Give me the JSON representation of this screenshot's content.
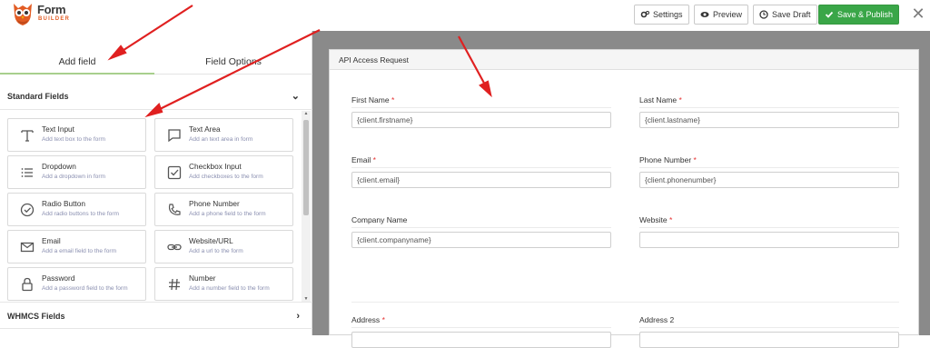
{
  "logo": {
    "brand": "Form",
    "sub": "BUILDER"
  },
  "toolbar": {
    "settings": "Settings",
    "preview": "Preview",
    "save_draft": "Save Draft",
    "save_publish": "Save & Publish"
  },
  "tabs": {
    "add_field": "Add field",
    "field_options": "Field Options"
  },
  "sections": {
    "standard": "Standard Fields",
    "whmcs": "WHMCS Fields"
  },
  "fields": [
    {
      "title": "Text Input",
      "desc": "Add text box to the form",
      "icon": "text-icon"
    },
    {
      "title": "Text Area",
      "desc": "Add an text area in form",
      "icon": "speech-bubble-icon"
    },
    {
      "title": "Dropdown",
      "desc": "Add a dropdown in form",
      "icon": "list-icon"
    },
    {
      "title": "Checkbox Input",
      "desc": "Add checkboxes to the form",
      "icon": "checkbox-icon"
    },
    {
      "title": "Radio Button",
      "desc": "Add radio buttons to the form",
      "icon": "radio-check-icon"
    },
    {
      "title": "Phone Number",
      "desc": "Add a phone field to the form",
      "icon": "phone-icon"
    },
    {
      "title": "Email",
      "desc": "Add a email field to the form",
      "icon": "envelope-icon"
    },
    {
      "title": "Website/URL",
      "desc": "Add a url to the form",
      "icon": "link-icon"
    },
    {
      "title": "Password",
      "desc": "Add a password field to the form",
      "icon": "lock-icon"
    },
    {
      "title": "Number",
      "desc": "Add a number field to the form",
      "icon": "hash-icon"
    }
  ],
  "form": {
    "title": "API Access Request",
    "first_name": {
      "label": "First Name",
      "value": "{client.firstname}"
    },
    "last_name": {
      "label": "Last Name",
      "value": "{client.lastname}"
    },
    "email": {
      "label": "Email",
      "value": "{client.email}"
    },
    "phone": {
      "label": "Phone Number",
      "value": "{client.phonenumber}"
    },
    "company": {
      "label": "Company Name",
      "value": "{client.companyname}"
    },
    "website": {
      "label": "Website",
      "value": ""
    },
    "address": {
      "label": "Address"
    },
    "address2": {
      "label": "Address 2"
    },
    "required_mark": "*"
  },
  "colors": {
    "accent_green": "#3aa648",
    "tab_underline": "#a8cf8d",
    "required_red": "#e53030",
    "annotation_red": "#e02020",
    "canvas_gray": "#8a8a8a"
  }
}
